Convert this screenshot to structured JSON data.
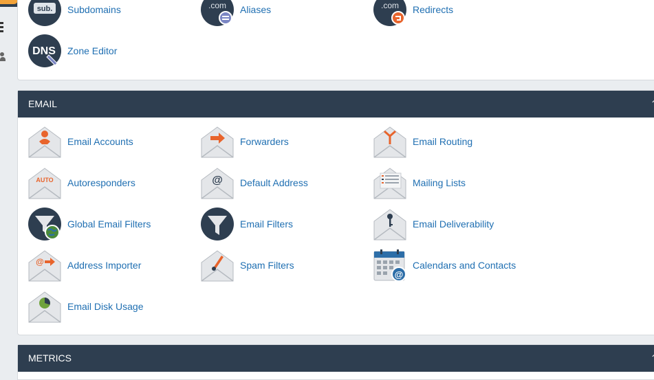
{
  "domains": {
    "items": [
      {
        "label": "Subdomains",
        "badge": "sub."
      },
      {
        "label": "Aliases",
        "badge": ".com"
      },
      {
        "label": "Redirects",
        "badge": ".com"
      },
      {
        "label": "Zone Editor",
        "badge": "DNS"
      }
    ]
  },
  "email": {
    "title": "EMAIL",
    "items": [
      {
        "label": "Email Accounts"
      },
      {
        "label": "Forwarders"
      },
      {
        "label": "Email Routing"
      },
      {
        "label": "Autoresponders",
        "badge": "AUTO"
      },
      {
        "label": "Default Address",
        "badge": "@"
      },
      {
        "label": "Mailing Lists"
      },
      {
        "label": "Global Email Filters"
      },
      {
        "label": "Email Filters"
      },
      {
        "label": "Email Deliverability"
      },
      {
        "label": "Address Importer",
        "badge": "@"
      },
      {
        "label": "Spam Filters"
      },
      {
        "label": "Calendars and Contacts",
        "badge": "@"
      },
      {
        "label": "Email Disk Usage"
      }
    ]
  },
  "metrics": {
    "title": "METRICS"
  },
  "colors": {
    "header_bg": "#2e3e50",
    "link": "#1f6fb2",
    "accent_orange": "#e8642c",
    "icon_navy": "#2e3e50"
  },
  "icons": {
    "envelope": "envelope-icon",
    "funnel": "funnel-icon",
    "calendar": "calendar-icon",
    "collapse": "chevron-icon"
  }
}
